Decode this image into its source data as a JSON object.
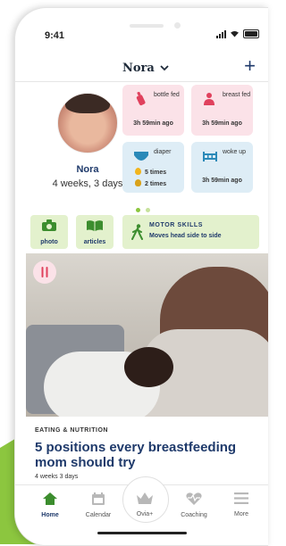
{
  "status": {
    "time": "9:41"
  },
  "header": {
    "baby_name": "Nora",
    "add_label": "+"
  },
  "profile": {
    "name": "Nora",
    "age": "4 weeks, 3 days"
  },
  "tiles": [
    {
      "label": "bottle fed",
      "value": "3h 59min ago",
      "color": "#fbe2e8"
    },
    {
      "label": "breast fed",
      "value": "3h 59min ago",
      "color": "#fbe2e8"
    },
    {
      "label": "diaper",
      "counts": [
        "5 times",
        "2 times"
      ],
      "color": "#deedf6"
    },
    {
      "label": "woke up",
      "value": "3h 59min ago",
      "color": "#deedf6"
    }
  ],
  "quick_actions": {
    "photo": "photo",
    "articles": "articles"
  },
  "milestone": {
    "title": "MOTOR SKILLS",
    "text": "Moves head side to side"
  },
  "article": {
    "category": "EATING & NUTRITION",
    "title": "5 positions every breastfeeding mom should try",
    "age": "4 weeks 3 days"
  },
  "tabs": {
    "home": "Home",
    "calendar": "Calendar",
    "ovia": "Ovia+",
    "coaching": "Coaching",
    "more": "More"
  },
  "colors": {
    "accent_green": "#8cc63f",
    "navy": "#1f3a6b",
    "pink_tile": "#fbe2e8",
    "blue_tile": "#deedf6"
  }
}
